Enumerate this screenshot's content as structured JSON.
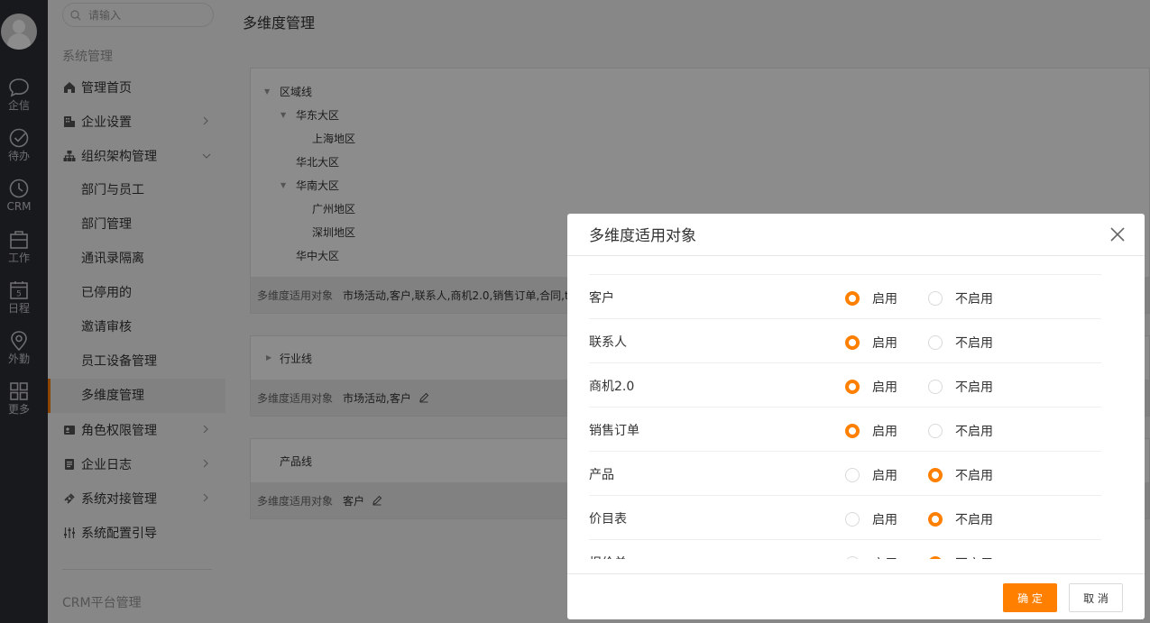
{
  "rail": {
    "items": [
      {
        "label": "企信",
        "icon": "chat-bubble-icon"
      },
      {
        "label": "待办",
        "icon": "check-circle-icon"
      },
      {
        "label": "CRM",
        "icon": "clock-icon"
      },
      {
        "label": "工作",
        "icon": "briefcase-icon"
      },
      {
        "label": "日程",
        "icon": "calendar-icon",
        "calendar_day": "5"
      },
      {
        "label": "外勤",
        "icon": "location-pin-icon"
      },
      {
        "label": "更多",
        "icon": "grid-icon"
      }
    ]
  },
  "nav": {
    "search_placeholder": "请输入",
    "section_system": "系统管理",
    "section_crm": "CRM平台管理",
    "items": [
      {
        "label": "管理首页",
        "icon": "home-icon"
      },
      {
        "label": "企业设置",
        "icon": "building-icon"
      },
      {
        "label": "组织架构管理",
        "icon": "org-chart-icon"
      },
      {
        "label": "角色权限管理",
        "icon": "id-card-icon"
      },
      {
        "label": "企业日志",
        "icon": "log-icon"
      },
      {
        "label": "系统对接管理",
        "icon": "link-icon"
      },
      {
        "label": "系统配置引导",
        "icon": "sliders-icon"
      }
    ],
    "sub_items": [
      "部门与员工",
      "部门管理",
      "通讯录隔离",
      "已停用的",
      "邀请审核",
      "员工设备管理",
      "多维度管理"
    ]
  },
  "main": {
    "title": "多维度管理",
    "footer_key": "多维度适用对象",
    "card1": {
      "tree": [
        "区域线",
        "华东大区",
        "上海地区",
        "华北大区",
        "华南大区",
        "广州地区",
        "深圳地区",
        "华中大区"
      ],
      "applies": "市场活动,客户,联系人,商机2.0,销售订单,合同,t("
    },
    "card2": {
      "title": "行业线",
      "applies": "市场活动,客户"
    },
    "card3": {
      "title": "产品线",
      "applies": "客户"
    }
  },
  "modal": {
    "title": "多维度适用对象",
    "enable_label": "启用",
    "disable_label": "不启用",
    "rows": [
      {
        "name": "客户",
        "enabled": true
      },
      {
        "name": "联系人",
        "enabled": true
      },
      {
        "name": "商机2.0",
        "enabled": true
      },
      {
        "name": "销售订单",
        "enabled": true
      },
      {
        "name": "产品",
        "enabled": false
      },
      {
        "name": "价目表",
        "enabled": false
      },
      {
        "name": "报价单",
        "enabled": false
      }
    ],
    "ok_label": "确 定",
    "cancel_label": "取 消",
    "accent_color": "#ff8000"
  }
}
